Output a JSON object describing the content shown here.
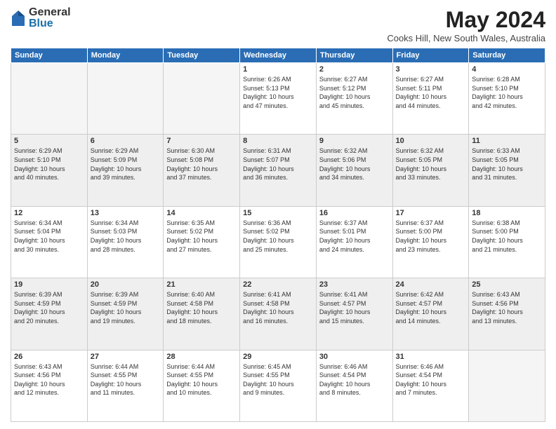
{
  "logo": {
    "general": "General",
    "blue": "Blue"
  },
  "title": "May 2024",
  "location": "Cooks Hill, New South Wales, Australia",
  "days_of_week": [
    "Sunday",
    "Monday",
    "Tuesday",
    "Wednesday",
    "Thursday",
    "Friday",
    "Saturday"
  ],
  "weeks": [
    [
      {
        "day": "",
        "info": "",
        "empty": true
      },
      {
        "day": "",
        "info": "",
        "empty": true
      },
      {
        "day": "",
        "info": "",
        "empty": true
      },
      {
        "day": "1",
        "info": "Sunrise: 6:26 AM\nSunset: 5:13 PM\nDaylight: 10 hours\nand 47 minutes.",
        "empty": false
      },
      {
        "day": "2",
        "info": "Sunrise: 6:27 AM\nSunset: 5:12 PM\nDaylight: 10 hours\nand 45 minutes.",
        "empty": false
      },
      {
        "day": "3",
        "info": "Sunrise: 6:27 AM\nSunset: 5:11 PM\nDaylight: 10 hours\nand 44 minutes.",
        "empty": false
      },
      {
        "day": "4",
        "info": "Sunrise: 6:28 AM\nSunset: 5:10 PM\nDaylight: 10 hours\nand 42 minutes.",
        "empty": false
      }
    ],
    [
      {
        "day": "5",
        "info": "Sunrise: 6:29 AM\nSunset: 5:10 PM\nDaylight: 10 hours\nand 40 minutes.",
        "empty": false
      },
      {
        "day": "6",
        "info": "Sunrise: 6:29 AM\nSunset: 5:09 PM\nDaylight: 10 hours\nand 39 minutes.",
        "empty": false
      },
      {
        "day": "7",
        "info": "Sunrise: 6:30 AM\nSunset: 5:08 PM\nDaylight: 10 hours\nand 37 minutes.",
        "empty": false
      },
      {
        "day": "8",
        "info": "Sunrise: 6:31 AM\nSunset: 5:07 PM\nDaylight: 10 hours\nand 36 minutes.",
        "empty": false
      },
      {
        "day": "9",
        "info": "Sunrise: 6:32 AM\nSunset: 5:06 PM\nDaylight: 10 hours\nand 34 minutes.",
        "empty": false
      },
      {
        "day": "10",
        "info": "Sunrise: 6:32 AM\nSunset: 5:05 PM\nDaylight: 10 hours\nand 33 minutes.",
        "empty": false
      },
      {
        "day": "11",
        "info": "Sunrise: 6:33 AM\nSunset: 5:05 PM\nDaylight: 10 hours\nand 31 minutes.",
        "empty": false
      }
    ],
    [
      {
        "day": "12",
        "info": "Sunrise: 6:34 AM\nSunset: 5:04 PM\nDaylight: 10 hours\nand 30 minutes.",
        "empty": false
      },
      {
        "day": "13",
        "info": "Sunrise: 6:34 AM\nSunset: 5:03 PM\nDaylight: 10 hours\nand 28 minutes.",
        "empty": false
      },
      {
        "day": "14",
        "info": "Sunrise: 6:35 AM\nSunset: 5:02 PM\nDaylight: 10 hours\nand 27 minutes.",
        "empty": false
      },
      {
        "day": "15",
        "info": "Sunrise: 6:36 AM\nSunset: 5:02 PM\nDaylight: 10 hours\nand 25 minutes.",
        "empty": false
      },
      {
        "day": "16",
        "info": "Sunrise: 6:37 AM\nSunset: 5:01 PM\nDaylight: 10 hours\nand 24 minutes.",
        "empty": false
      },
      {
        "day": "17",
        "info": "Sunrise: 6:37 AM\nSunset: 5:00 PM\nDaylight: 10 hours\nand 23 minutes.",
        "empty": false
      },
      {
        "day": "18",
        "info": "Sunrise: 6:38 AM\nSunset: 5:00 PM\nDaylight: 10 hours\nand 21 minutes.",
        "empty": false
      }
    ],
    [
      {
        "day": "19",
        "info": "Sunrise: 6:39 AM\nSunset: 4:59 PM\nDaylight: 10 hours\nand 20 minutes.",
        "empty": false
      },
      {
        "day": "20",
        "info": "Sunrise: 6:39 AM\nSunset: 4:59 PM\nDaylight: 10 hours\nand 19 minutes.",
        "empty": false
      },
      {
        "day": "21",
        "info": "Sunrise: 6:40 AM\nSunset: 4:58 PM\nDaylight: 10 hours\nand 18 minutes.",
        "empty": false
      },
      {
        "day": "22",
        "info": "Sunrise: 6:41 AM\nSunset: 4:58 PM\nDaylight: 10 hours\nand 16 minutes.",
        "empty": false
      },
      {
        "day": "23",
        "info": "Sunrise: 6:41 AM\nSunset: 4:57 PM\nDaylight: 10 hours\nand 15 minutes.",
        "empty": false
      },
      {
        "day": "24",
        "info": "Sunrise: 6:42 AM\nSunset: 4:57 PM\nDaylight: 10 hours\nand 14 minutes.",
        "empty": false
      },
      {
        "day": "25",
        "info": "Sunrise: 6:43 AM\nSunset: 4:56 PM\nDaylight: 10 hours\nand 13 minutes.",
        "empty": false
      }
    ],
    [
      {
        "day": "26",
        "info": "Sunrise: 6:43 AM\nSunset: 4:56 PM\nDaylight: 10 hours\nand 12 minutes.",
        "empty": false
      },
      {
        "day": "27",
        "info": "Sunrise: 6:44 AM\nSunset: 4:55 PM\nDaylight: 10 hours\nand 11 minutes.",
        "empty": false
      },
      {
        "day": "28",
        "info": "Sunrise: 6:44 AM\nSunset: 4:55 PM\nDaylight: 10 hours\nand 10 minutes.",
        "empty": false
      },
      {
        "day": "29",
        "info": "Sunrise: 6:45 AM\nSunset: 4:55 PM\nDaylight: 10 hours\nand 9 minutes.",
        "empty": false
      },
      {
        "day": "30",
        "info": "Sunrise: 6:46 AM\nSunset: 4:54 PM\nDaylight: 10 hours\nand 8 minutes.",
        "empty": false
      },
      {
        "day": "31",
        "info": "Sunrise: 6:46 AM\nSunset: 4:54 PM\nDaylight: 10 hours\nand 7 minutes.",
        "empty": false
      },
      {
        "day": "",
        "info": "",
        "empty": true
      }
    ]
  ],
  "shaded_rows": [
    1,
    3
  ]
}
